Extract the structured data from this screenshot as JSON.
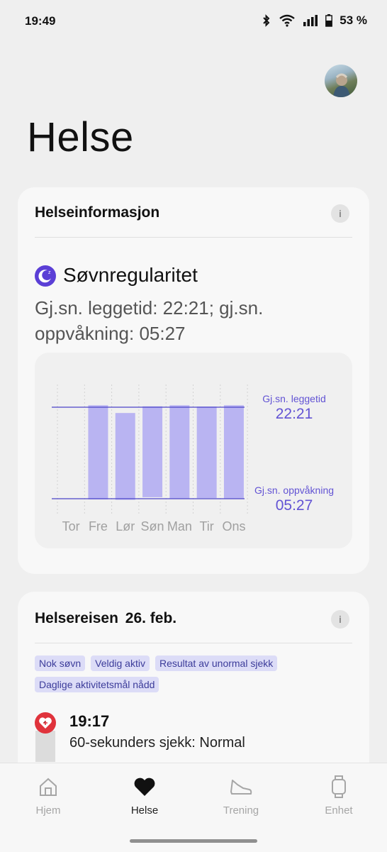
{
  "status_bar": {
    "time": "19:49",
    "battery": "53 %"
  },
  "page": {
    "title": "Helse"
  },
  "health_info_card": {
    "title": "Helseinformasjon",
    "info_icon": "i",
    "sleep": {
      "title": "Søvnregularitet",
      "subtitle": "Gj.sn. leggetid: 22:21; gj.sn. oppvåkning: 05:27"
    }
  },
  "chart_data": {
    "type": "bar",
    "title": "Søvnregularitet",
    "categories": [
      "Tor",
      "Fre",
      "Lør",
      "Søn",
      "Man",
      "Tir",
      "Ons"
    ],
    "series": [
      {
        "bedtime": [
          "",
          "22:12",
          "22:48",
          "22:17",
          "22:12",
          "22:18",
          "22:12"
        ],
        "wake": [
          "",
          "05:30",
          "05:32",
          "05:20",
          "05:25",
          "05:24",
          "05:25"
        ]
      }
    ],
    "reference_lines": [
      {
        "label": "Gj.sn. leggetid",
        "value": "22:21"
      },
      {
        "label": "Gj.sn. oppvåkning",
        "value": "05:27"
      }
    ]
  },
  "journey_card": {
    "title": "Helsereisen",
    "date": "26. feb.",
    "info_icon": "i",
    "tags": [
      "Nok søvn",
      "Veldig aktiv",
      "Resultat av unormal sjekk",
      "Daglige aktivitetsmål nådd"
    ],
    "event": {
      "time": "19:17",
      "description": "60-sekunders sjekk: Normal"
    }
  },
  "nav": {
    "items": [
      {
        "label": "Hjem",
        "icon": "home-icon"
      },
      {
        "label": "Helse",
        "icon": "heart-icon"
      },
      {
        "label": "Trening",
        "icon": "shoe-icon"
      },
      {
        "label": "Enhet",
        "icon": "watch-icon"
      }
    ]
  },
  "colors": {
    "accent": "#6253d4",
    "bar": "#b9b4f2",
    "alert": "#e0333c"
  }
}
